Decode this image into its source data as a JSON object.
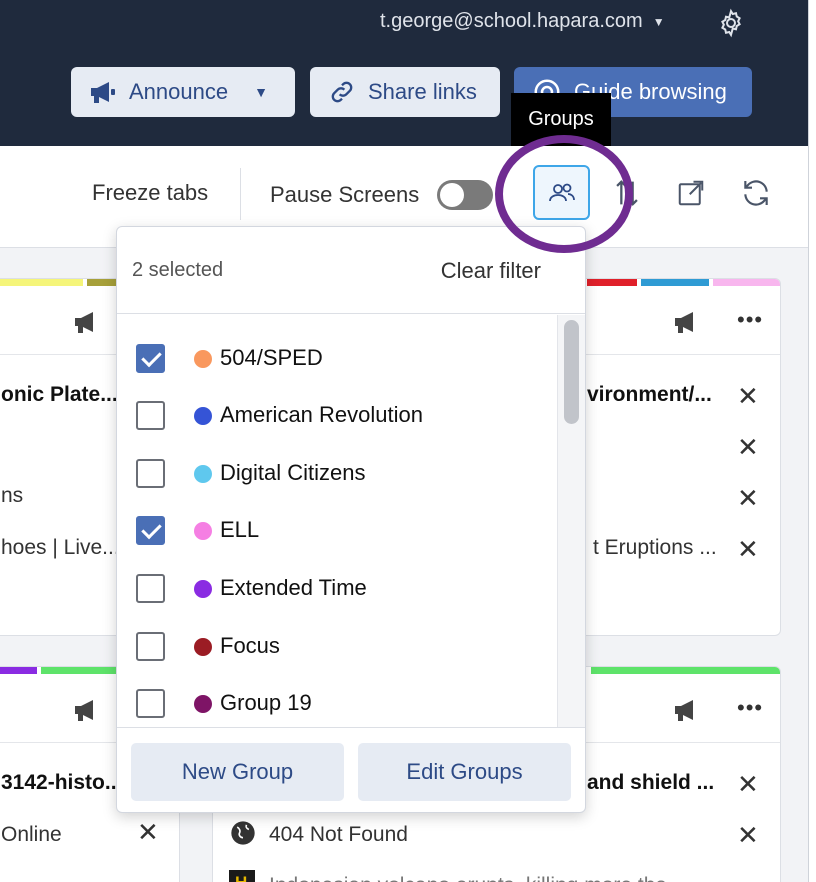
{
  "header": {
    "account_email": "t.george@school.hapara.com",
    "announce_label": "Announce",
    "share_links_label": "Share links",
    "guide_browsing_label": "Guide browsing"
  },
  "tooltip": {
    "groups": "Groups"
  },
  "toolbar": {
    "freeze_tabs_label": "Freeze tabs",
    "pause_screens_label": "Pause Screens",
    "pause_screens_on": false
  },
  "groups_dropdown": {
    "selected_count": "2 selected",
    "clear_filter_label": "Clear filter",
    "items": [
      {
        "label": "504/SPED",
        "checked": true,
        "color": "#f9985e"
      },
      {
        "label": "American Revolution",
        "checked": false,
        "color": "#3554d6"
      },
      {
        "label": "Digital Citizens",
        "checked": false,
        "color": "#5fc8ee"
      },
      {
        "label": "ELL",
        "checked": true,
        "color": "#f57fe3"
      },
      {
        "label": "Extended Time",
        "checked": false,
        "color": "#8a2be2"
      },
      {
        "label": "Focus",
        "checked": false,
        "color": "#9b1c24"
      },
      {
        "label": "Group 19",
        "checked": false,
        "color": "#7e1466"
      }
    ],
    "new_group_label": "New Group",
    "edit_groups_label": "Edit Groups"
  },
  "background_cards": {
    "left_top": {
      "title": "onic Plate...",
      "line2": "ns",
      "line3": "hoes | Live..."
    },
    "left_bottom": {
      "title": "3142-histo...",
      "line2": "Online"
    },
    "right_top": {
      "title": "vironment/...",
      "line3": "t Eruptions ..."
    },
    "right_bottom": {
      "title": "and shield ...",
      "line2": "404 Not Found",
      "line3": "Indonesian volcano erupts, killing more tha..."
    }
  },
  "colors": {
    "header_bg": "#1f2a3d",
    "accent": "#4a6fb6",
    "highlight_ring": "#6f2c91",
    "active_border": "#3ea6e8"
  }
}
